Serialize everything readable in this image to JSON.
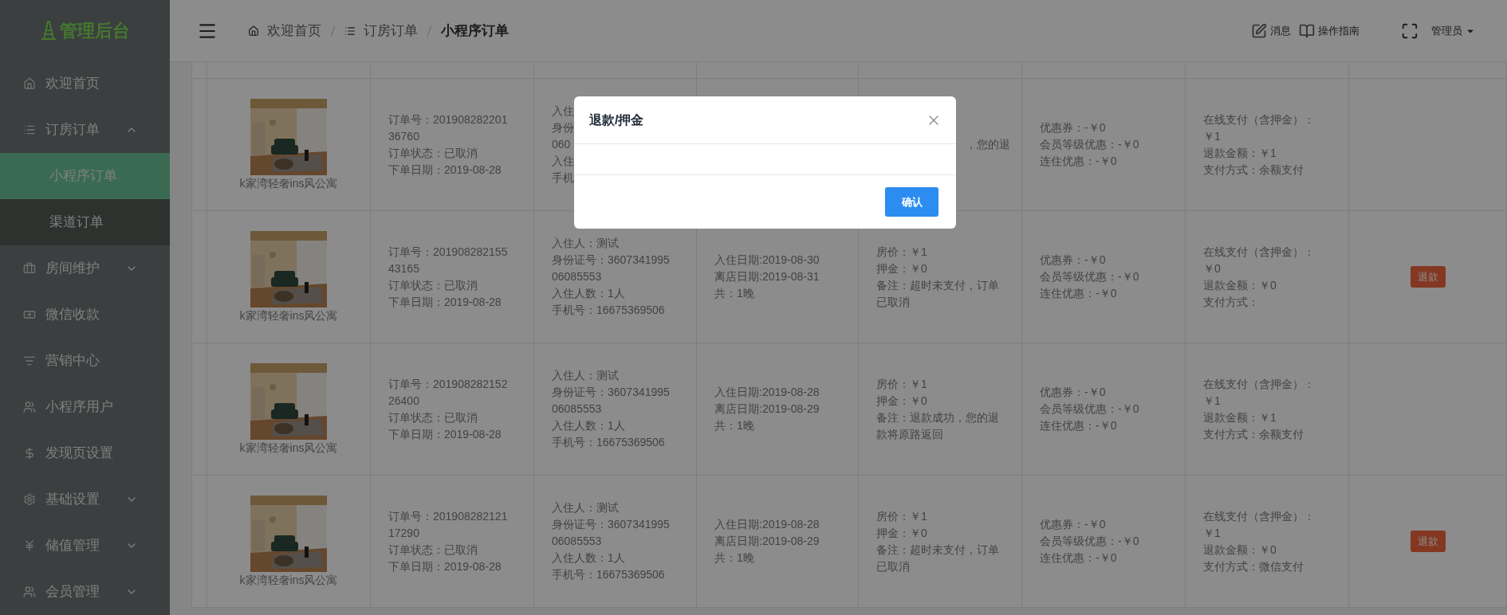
{
  "sidebar": {
    "logo": "管理后台",
    "items": [
      {
        "label": "欢迎首页"
      },
      {
        "label": "订房订单",
        "expanded": true,
        "children": [
          {
            "label": "小程序订单",
            "selected": true
          },
          {
            "label": "渠道订单",
            "selected": false
          }
        ]
      },
      {
        "label": "房间维护",
        "expanded": false
      },
      {
        "label": "微信收款"
      },
      {
        "label": "营销中心"
      },
      {
        "label": "小程序用户"
      },
      {
        "label": "发现页设置"
      },
      {
        "label": "基础设置",
        "expanded": false
      },
      {
        "label": "储值管理",
        "expanded": false
      },
      {
        "label": "会员管理",
        "expanded": false
      }
    ]
  },
  "header": {
    "breadcrumb": [
      {
        "label": "欢迎首页",
        "current": false
      },
      {
        "label": "订房订单",
        "current": false
      },
      {
        "label": "小程序订单",
        "current": true
      }
    ],
    "actions": [
      {
        "label": "消息"
      },
      {
        "label": "操作指南"
      }
    ],
    "user": "管理员"
  },
  "orders": [
    {
      "room": "k家湾轻奢ins风公寓",
      "order": [
        "订单号：20190828220136760",
        "订单状态：已取消",
        "下单日期：2019-08-28"
      ],
      "guest_fragments": [
        "入住",
        "身份",
        "060",
        "入住",
        "手机"
      ],
      "note_fragment": "，您的退",
      "discounts": [
        "优惠券：-￥0",
        "会员等级优惠：-￥0",
        "连住优惠：-￥0"
      ],
      "payment": [
        "在线支付（含押金）：￥1",
        "退款金额：￥1",
        "支付方式：余额支付"
      ]
    },
    {
      "room": "k家湾轻奢ins风公寓",
      "order": [
        "订单号：20190828215543165",
        "订单状态：已取消",
        "下单日期：2019-08-28"
      ],
      "guest": [
        "入住人：测试",
        "身份证号：360734199506085553",
        "入住人数：1人",
        "手机号：16675369506"
      ],
      "stay": [
        "入住日期:2019-08-30",
        "离店日期:2019-08-31",
        "共：1晚"
      ],
      "price": [
        "房价：￥1",
        "押金：￥0",
        "备注：超时未支付，订单已取消"
      ],
      "discounts": [
        "优惠券：-￥0",
        "会员等级优惠：-￥0",
        "连住优惠：-￥0"
      ],
      "payment": [
        "在线支付（含押金）：￥0",
        "退款金额：￥0",
        "支付方式："
      ],
      "action": "退款"
    },
    {
      "room": "k家湾轻奢ins风公寓",
      "order": [
        "订单号：20190828215226400",
        "订单状态：已取消",
        "下单日期：2019-08-28"
      ],
      "guest": [
        "入住人：测试",
        "身份证号：360734199506085553",
        "入住人数：1人",
        "手机号：16675369506"
      ],
      "stay": [
        "入住日期:2019-08-28",
        "离店日期:2019-08-29",
        "共：1晚"
      ],
      "price": [
        "房价：￥1",
        "押金：￥0",
        "备注：退款成功，您的退款将原路返回"
      ],
      "discounts": [
        "优惠券：-￥0",
        "会员等级优惠：-￥0",
        "连住优惠：-￥0"
      ],
      "payment": [
        "在线支付（含押金）：￥1",
        "退款金额：￥1",
        "支付方式：余额支付"
      ]
    },
    {
      "room": "k家湾轻奢ins风公寓",
      "order": [
        "订单号：20190828212117290",
        "订单状态：已取消",
        "下单日期：2019-08-28"
      ],
      "guest": [
        "入住人：测试",
        "身份证号：360734199506085553",
        "入住人数：1人",
        "手机号：16675369506"
      ],
      "stay": [
        "入住日期:2019-08-28",
        "离店日期:2019-08-29",
        "共：1晚"
      ],
      "price": [
        "房价：￥1",
        "押金：￥0",
        "备注：超时未支付，订单已取消"
      ],
      "discounts": [
        "优惠券：-￥0",
        "会员等级优惠：-￥0",
        "连住优惠：-￥0"
      ],
      "payment": [
        "在线支付（含押金）：￥1",
        "退款金额：￥0",
        "支付方式：微信支付"
      ],
      "action": "退款"
    }
  ],
  "dialog": {
    "title": "退款/押金",
    "confirm": "确认"
  }
}
